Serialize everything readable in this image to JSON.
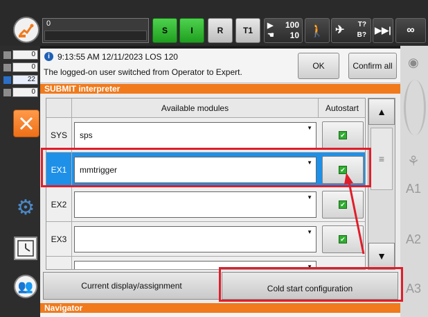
{
  "topbar": {
    "status_value": "0",
    "s_label": "S",
    "i_label": "I",
    "r_label": "R",
    "mode_label": "T1",
    "override_run": "100",
    "override_jog": "10",
    "t_label": "T?",
    "b_label": "B?",
    "infinity": "∞"
  },
  "left_indicators": [
    {
      "value": "0"
    },
    {
      "value": "0"
    },
    {
      "value": "22"
    },
    {
      "value": "0"
    }
  ],
  "message": {
    "time_stamp": "9:13:55 AM 12/11/2023 LOS 120",
    "text": "The logged-on user switched from Operator to Expert.",
    "ok_label": "OK",
    "confirm_all_label": "Confirm all"
  },
  "submit_section_title": "SUBMIT interpreter",
  "table": {
    "headers": {
      "modules": "Available modules",
      "autostart": "Autostart"
    },
    "rows": [
      {
        "name": "SYS",
        "module": "sps",
        "autostart": true,
        "selected": false
      },
      {
        "name": "EX1",
        "module": "mmtrigger",
        "autostart": true,
        "selected": true
      },
      {
        "name": "EX2",
        "module": "",
        "autostart": true,
        "selected": false
      },
      {
        "name": "EX3",
        "module": "",
        "autostart": true,
        "selected": false
      }
    ]
  },
  "buttons": {
    "current_display": "Current display/assignment",
    "cold_start": "Cold start configuration"
  },
  "navigator_title": "Navigator",
  "right_axes": [
    "A1",
    "A2",
    "A3"
  ],
  "colors": {
    "accent_orange": "#f07a1c",
    "selection_blue": "#1e90e8",
    "annotation_red": "#e01d2a",
    "status_green": "#2fae2f"
  }
}
